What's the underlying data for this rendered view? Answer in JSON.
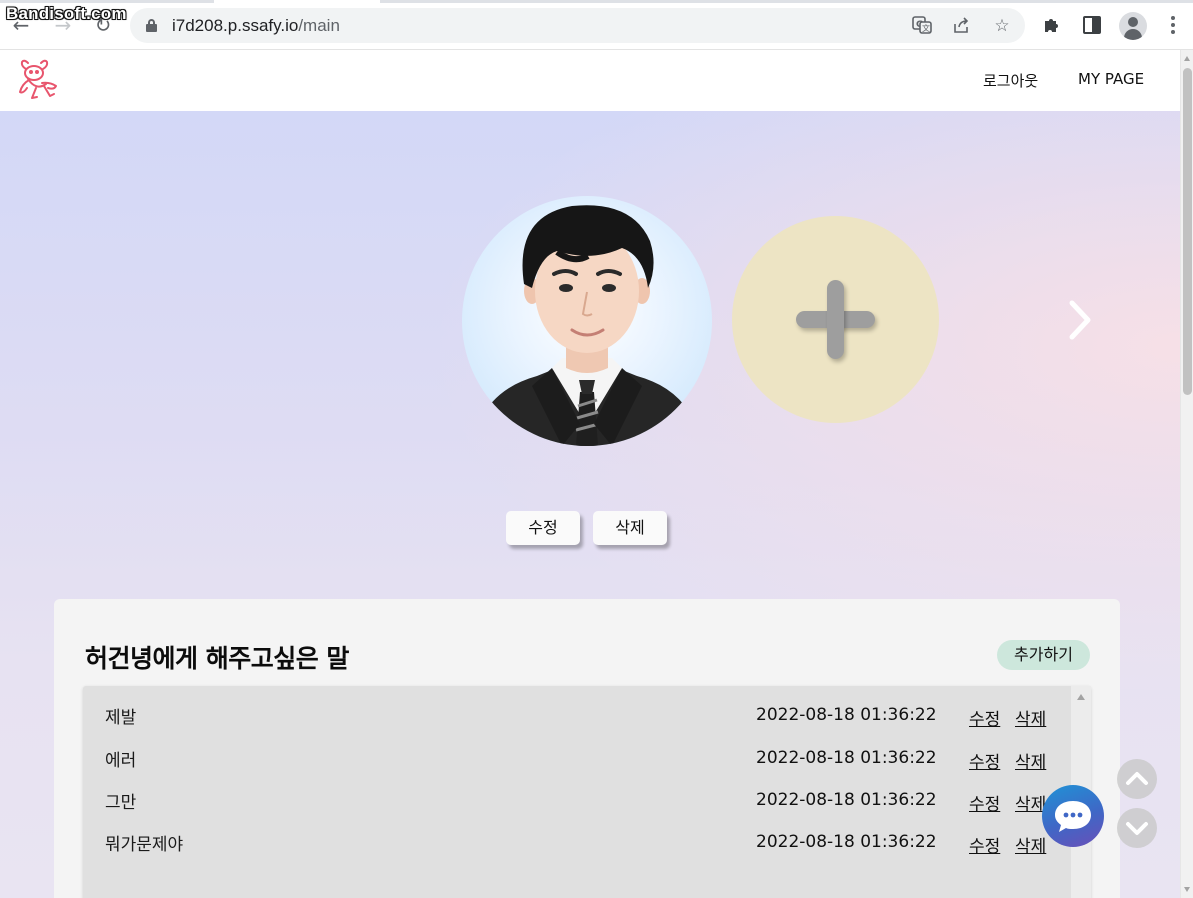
{
  "watermark": "Bandisoft.com",
  "browser": {
    "url_host": "i7d208.p.ssafy.io",
    "url_path": "/main"
  },
  "header": {
    "logout_label": "로그아웃",
    "mypage_label": "MY PAGE"
  },
  "carousel": {
    "edit_label": "수정",
    "delete_label": "삭제"
  },
  "messages": {
    "title": "허건녕에게 해주고싶은 말",
    "add_label": "추가하기",
    "edit_link": "수정",
    "delete_link": "삭제",
    "items": [
      {
        "text": "제발",
        "date": "2022-08-18 01:36:22"
      },
      {
        "text": "에러",
        "date": "2022-08-18 01:36:22"
      },
      {
        "text": "그만",
        "date": "2022-08-18 01:36:22"
      },
      {
        "text": "뭐가문제야",
        "date": "2022-08-18 01:36:22"
      }
    ]
  },
  "colors": {
    "add_circle": "#ede4c4",
    "add_button": "#cde7dc",
    "chat_gradient_start": "#1f93d6",
    "chat_gradient_end": "#6a4fb8"
  }
}
